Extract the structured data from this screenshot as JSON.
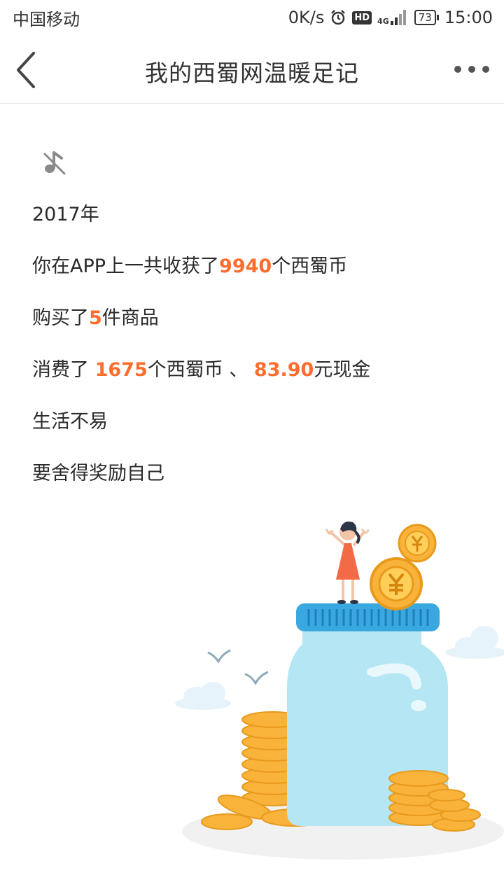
{
  "status_bar": {
    "carrier": "中国移动",
    "net_speed": "0K/s",
    "alarm_icon": "alarm-clock-icon",
    "hd_badge": "HD",
    "network_type": "4G",
    "battery": "73",
    "time": "15:00"
  },
  "nav": {
    "back_icon": "chevron-left-icon",
    "title": "我的西蜀网温暖足记",
    "more_icon": "more-dots-icon"
  },
  "music_icon": "music-muted-icon",
  "summary": {
    "year": "2017年",
    "coins_prefix": "你在APP上一共收获了",
    "coins_earned": "9940",
    "coins_suffix": "个西蜀币",
    "purchase_prefix": "购买了",
    "items_bought": "5",
    "purchase_suffix": "件商品",
    "spend_prefix": "消费了 ",
    "coins_spent": "1675",
    "spend_middle": "个西蜀币 、 ",
    "cash_spent": "83.90",
    "spend_suffix": "元现金",
    "line_life": "生活不易",
    "line_reward": "要舍得奖励自己"
  },
  "colors": {
    "highlight": "#ff6d2e",
    "jar_body": "#b5e6f3",
    "jar_lid": "#3aa8e0",
    "coin": "#f9b23a",
    "dress": "#f36a47"
  }
}
